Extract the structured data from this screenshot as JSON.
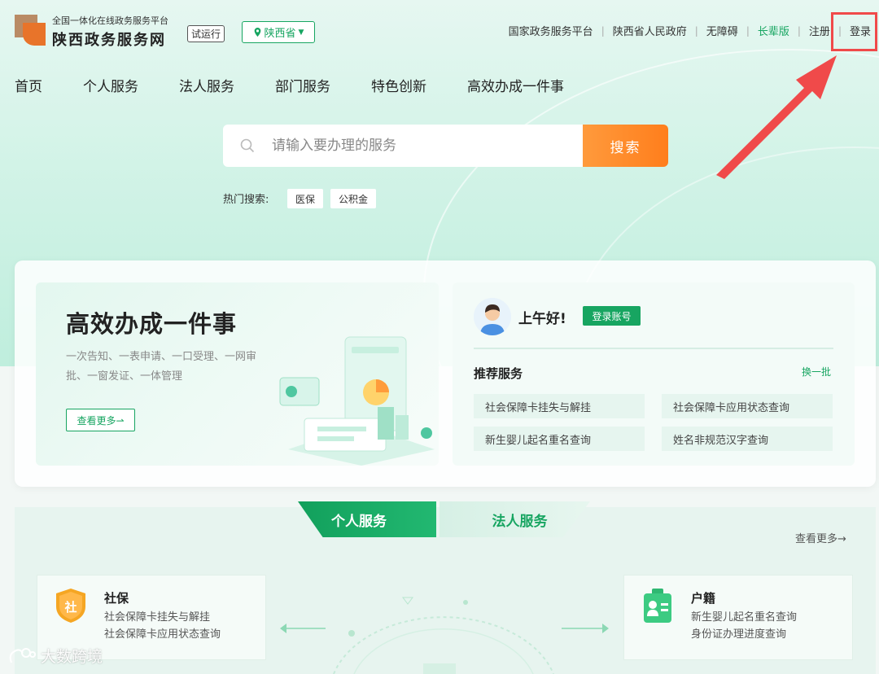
{
  "header": {
    "logo_subtitle": "全国一体化在线政务服务平台",
    "logo_title": "陕西政务服务网",
    "beta_badge": "试运行",
    "region": "陕西省",
    "toplinks": [
      {
        "label": "国家政务服务平台"
      },
      {
        "label": "陕西省人民政府"
      },
      {
        "label": "无障碍"
      },
      {
        "label": "长辈版"
      },
      {
        "label": "注册"
      },
      {
        "label": "登录"
      }
    ]
  },
  "nav": {
    "items": [
      "首页",
      "个人服务",
      "法人服务",
      "部门服务",
      "特色创新",
      "高效办成一件事"
    ]
  },
  "search": {
    "placeholder": "请输入要办理的服务",
    "button": "搜索",
    "hot_label": "热门搜索:",
    "hot_tags": [
      "医保",
      "公积金"
    ]
  },
  "promo": {
    "title": "高效办成一件事",
    "desc": "一次告知、一表申请、一口受理、一网审批、一窗发证、一体管理",
    "more": "查看更多⇀"
  },
  "recommend": {
    "greeting": "上午好!",
    "login_button": "登录账号",
    "title": "推荐服务",
    "refresh": "换一批",
    "items": [
      "社会保障卡挂失与解挂",
      "社会保障卡应用状态查询",
      "新生婴儿起名重名查询",
      "姓名非规范汉字查询"
    ]
  },
  "service_tabs": {
    "active": "个人服务",
    "inactive": "法人服务",
    "more": "查看更多→",
    "cards": [
      {
        "icon": "shield-icon",
        "icon_text": "社",
        "name": "社保",
        "lines": [
          "社会保障卡挂失与解挂",
          "社会保障卡应用状态查询"
        ]
      },
      {
        "icon": "id-card-icon",
        "name": "户籍",
        "lines": [
          "新生婴儿起名重名查询",
          "身份证办理进度查询"
        ]
      }
    ]
  },
  "watermark": "大数跨境",
  "colors": {
    "brand_green": "#17a561",
    "search_orange": "#ff8a2a",
    "highlight_red": "#f04a4a"
  }
}
